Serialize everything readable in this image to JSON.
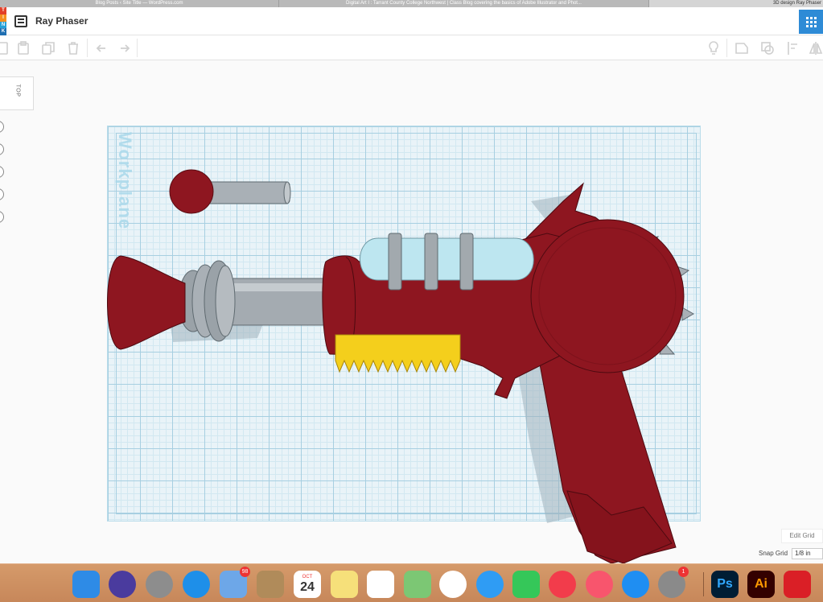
{
  "browser": {
    "tabs": [
      {
        "label": "Blog Posts ‹ Site Title — WordPress.com"
      },
      {
        "label": "Digital Art I : Tarrant County College Northwest | Class Blog covering the basics of Adobe Illustrator and Phot..."
      },
      {
        "label": "3D design Ray Phaser"
      }
    ]
  },
  "app": {
    "logo_letters": [
      "T",
      "I",
      "N",
      "K"
    ],
    "design_title": "Ray Phaser",
    "accent_color": "#2e8bd6"
  },
  "toolbar": {
    "left_icons": [
      "copy-icon",
      "paste-icon",
      "duplicate-icon",
      "delete-icon",
      "undo-icon",
      "redo-icon"
    ],
    "right_icons": [
      "lightbulb-icon",
      "group-icon",
      "ungroup-icon",
      "align-icon",
      "mirror-icon"
    ]
  },
  "viewcube": {
    "face": "TOP"
  },
  "workplane": {
    "label": "Workplane",
    "color": "#e9f3f8"
  },
  "model": {
    "body_color": "#8e1620",
    "barrel_color": "#a9b0b6",
    "glass_color": "#bde6f0",
    "teeth_color": "#f4cf1c"
  },
  "grid_controls": {
    "edit_grid_label": "Edit Grid",
    "snap_grid_label": "Snap Grid",
    "snap_grid_value": "1/8 in"
  },
  "dock": {
    "items": [
      {
        "name": "finder",
        "glyph": "",
        "color": "#2e8be6"
      },
      {
        "name": "siri",
        "glyph": "",
        "color": "#4a3b9e"
      },
      {
        "name": "launchpad",
        "glyph": "",
        "color": "#8d8d8d"
      },
      {
        "name": "safari",
        "glyph": "",
        "color": "#1e8fe9"
      },
      {
        "name": "mail",
        "glyph": "",
        "color": "#6da7e8",
        "badge": "98"
      },
      {
        "name": "contacts",
        "glyph": "",
        "color": "#b08b5a"
      },
      {
        "name": "calendar",
        "glyph": "24",
        "month": "OCT",
        "color": "#ffffff"
      },
      {
        "name": "notes",
        "glyph": "",
        "color": "#f6e07a"
      },
      {
        "name": "reminders",
        "glyph": "",
        "color": "#ffffff"
      },
      {
        "name": "maps",
        "glyph": "",
        "color": "#7cc774"
      },
      {
        "name": "photos",
        "glyph": "",
        "color": "#ffffff"
      },
      {
        "name": "messages",
        "glyph": "",
        "color": "#2f9cf4"
      },
      {
        "name": "facetime",
        "glyph": "",
        "color": "#35c759"
      },
      {
        "name": "news",
        "glyph": "",
        "color": "#f23c4b"
      },
      {
        "name": "music",
        "glyph": "",
        "color": "#f8556d"
      },
      {
        "name": "app-store",
        "glyph": "",
        "color": "#1f8ef2"
      },
      {
        "name": "system-preferences",
        "glyph": "",
        "color": "#8a8a8a",
        "badge": "1"
      },
      {
        "name": "photoshop",
        "glyph": "Ps",
        "color": "#001d34",
        "text_color": "#31a8ff"
      },
      {
        "name": "illustrator",
        "glyph": "Ai",
        "color": "#330000",
        "text_color": "#ff9a00"
      },
      {
        "name": "creative-cloud",
        "glyph": "",
        "color": "#da1f26"
      }
    ]
  }
}
